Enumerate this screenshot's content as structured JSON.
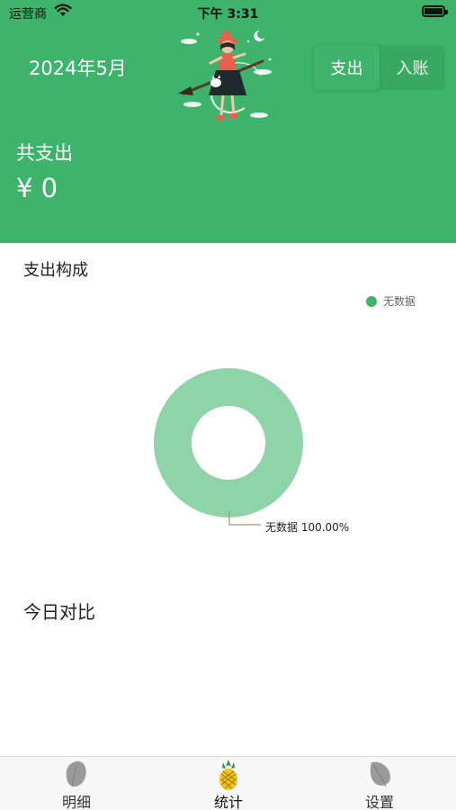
{
  "status_bar": {
    "carrier": "运营商",
    "time": "下午 3:31"
  },
  "header": {
    "month": "2024年5月",
    "segments": [
      {
        "label": "支出",
        "active": true
      },
      {
        "label": "入账",
        "active": false
      }
    ],
    "total_label": "共支出",
    "total_amount": "¥ 0",
    "accent_color": "#3db36b"
  },
  "composition": {
    "title": "支出构成",
    "legend": [
      {
        "label": "无数据",
        "color": "#3db36b"
      }
    ],
    "slice_label": "无数据 100.00%"
  },
  "chart_data": {
    "type": "pie",
    "categories": [
      "无数据"
    ],
    "values": [
      100.0
    ],
    "colors": [
      "#8fd3a8"
    ]
  },
  "daily": {
    "title": "今日对比"
  },
  "tabbar": {
    "items": [
      {
        "label": "明细",
        "icon": "leaf-icon"
      },
      {
        "label": "统计",
        "icon": "pineapple-icon"
      },
      {
        "label": "设置",
        "icon": "leaf-icon"
      }
    ]
  }
}
